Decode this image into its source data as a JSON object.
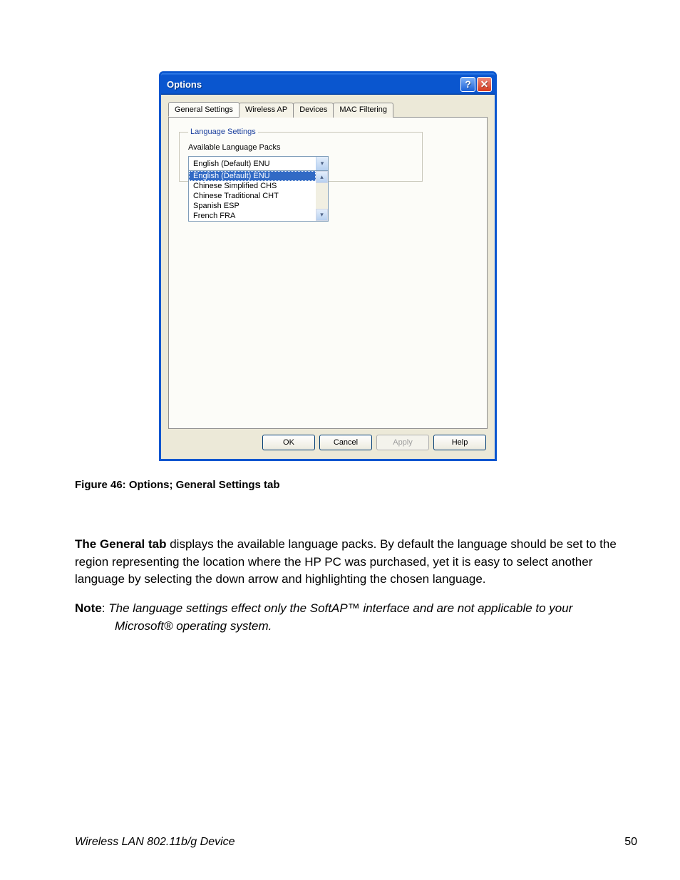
{
  "window": {
    "title": "Options",
    "tabs": [
      "General Settings",
      "Wireless AP",
      "Devices",
      "MAC Filtering"
    ],
    "active_tab": 0,
    "group_legend": "Language Settings",
    "available_label": "Available Language Packs",
    "combo_value": "English (Default) ENU",
    "dropdown_items": [
      "English (Default) ENU",
      "Chinese Simplified CHS",
      "Chinese Traditional CHT",
      "Spanish ESP",
      "French FRA"
    ],
    "selected_index": 0,
    "buttons": {
      "ok": "OK",
      "cancel": "Cancel",
      "apply": "Apply",
      "help": "Help"
    }
  },
  "figure_caption": "Figure 46: Options; General Settings tab",
  "body": {
    "bold_lead": "The General tab",
    "rest": " displays the available language packs.  By default the language should be set to the region representing the location where the HP PC was purchased, yet it is easy to select another language by selecting the down arrow and highlighting the chosen language."
  },
  "note": {
    "label": "Note",
    "sep": ":   ",
    "line1_ital": "The language settings effect only the SoftAP™  interface and are not applicable to your",
    "line2_ital": "Microsoft® operating system."
  },
  "footer": {
    "left": "Wireless LAN 802.11b/g Device",
    "page": "50"
  }
}
